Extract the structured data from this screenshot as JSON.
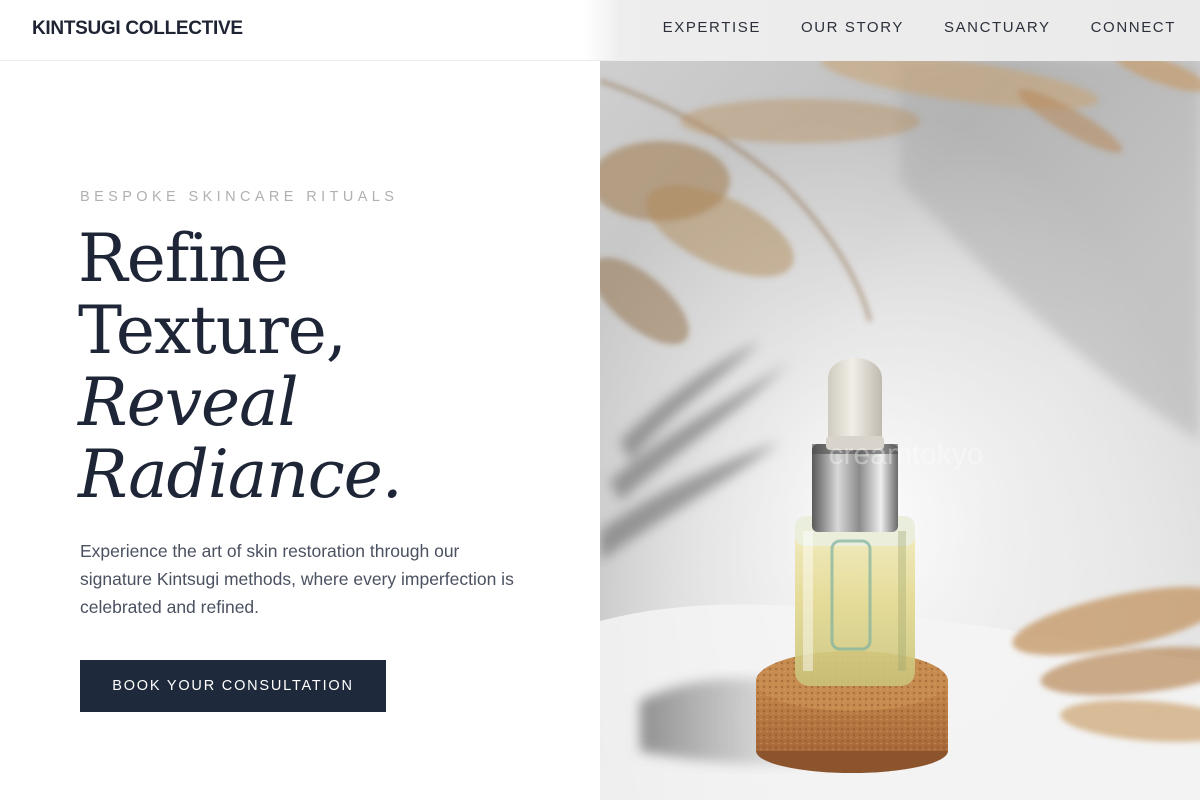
{
  "header": {
    "logo": "KINTSUGI COLLECTIVE",
    "nav": [
      {
        "label": "EXPERTISE"
      },
      {
        "label": "OUR STORY"
      },
      {
        "label": "SANCTUARY"
      },
      {
        "label": "CONNECT"
      }
    ]
  },
  "hero": {
    "eyebrow": "BESPOKE SKINCARE RITUALS",
    "headline": {
      "line1": "Refine",
      "line2": "Texture,",
      "line3": "Reveal",
      "line4": "Radiance."
    },
    "lead": "Experience the art of skin restoration through our signature Kintsugi methods, where every imperfection is celebrated and refined.",
    "cta_label": "BOOK YOUR CONSULTATION"
  },
  "image": {
    "subject": "serum-dropper-bottle-on-cork-with-pampas-grass",
    "watermark": "creamtokyo"
  },
  "colors": {
    "ink": "#1e293b",
    "eyebrow": "#b0b0b0",
    "body_text": "#4a5160",
    "cta_bg": "#1e293b",
    "cta_text": "#ffffff"
  }
}
